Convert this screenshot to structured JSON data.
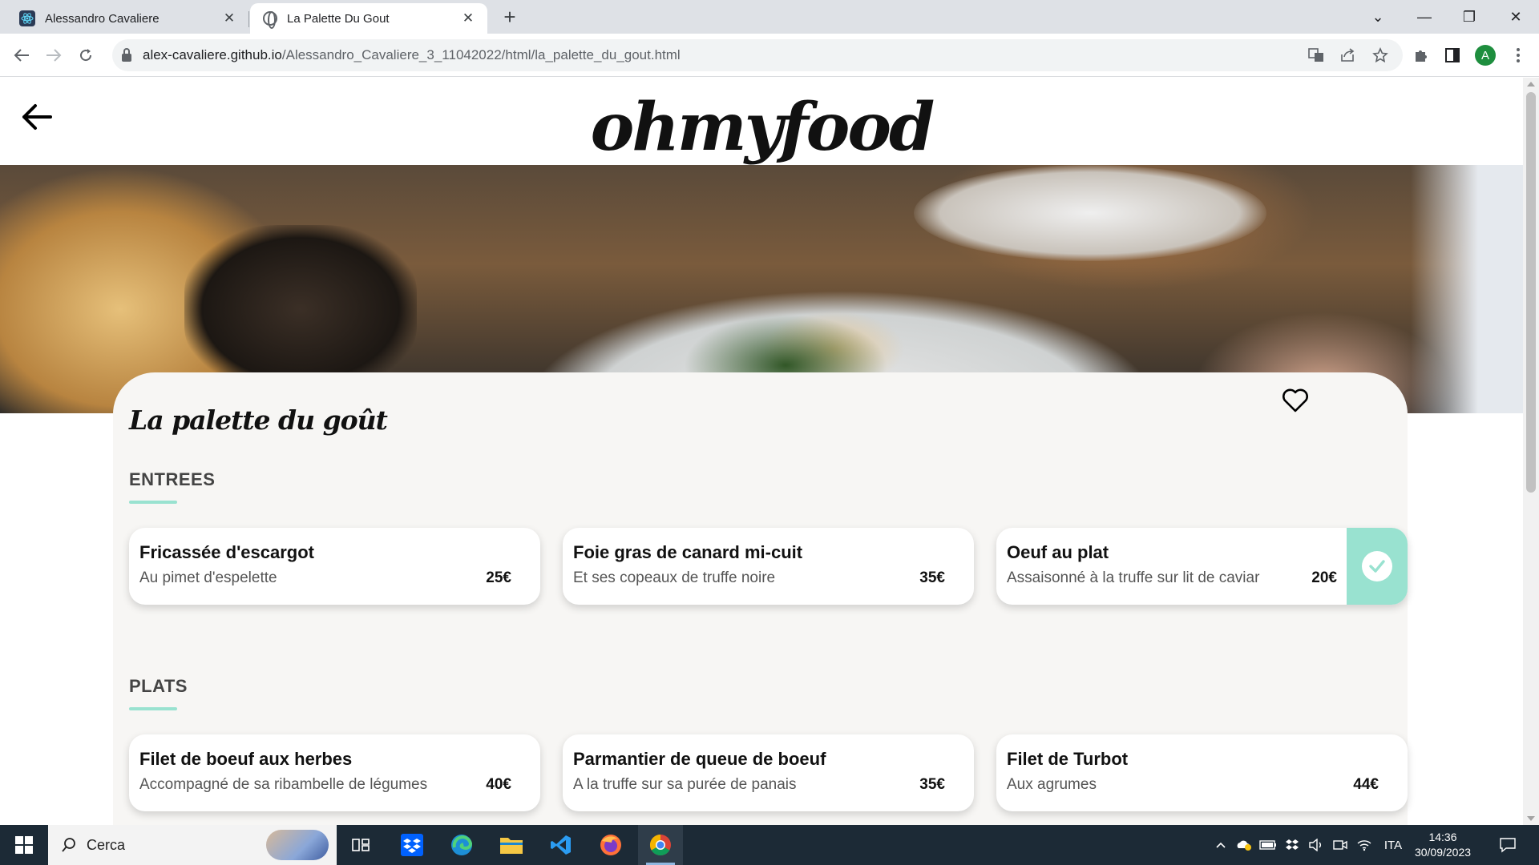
{
  "browser": {
    "tabs": [
      {
        "title": "Alessandro Cavaliere",
        "close": "✕"
      },
      {
        "title": "La Palette Du Gout",
        "close": "✕"
      }
    ],
    "new_tab": "+",
    "window_controls": {
      "dropdown": "⌄",
      "minimize": "—",
      "restore": "❐",
      "close": "✕"
    },
    "url_host": "alex-cavaliere.github.io",
    "url_path": "/Alessandro_Cavaliere_3_11042022/html/la_palette_du_gout.html",
    "profile_initial": "A"
  },
  "site": {
    "logo": "ohmyfood",
    "restaurant_name": "La palette du goût",
    "accent_color": "#99e2d0",
    "sections": [
      {
        "title": "ENTREES",
        "dishes": [
          {
            "name": "Fricassée d'escargot",
            "description": "Au pimet d'espelette",
            "price": "25€",
            "selected": false
          },
          {
            "name": "Foie gras de canard mi-cuit",
            "description": "Et ses copeaux de truffe noire",
            "price": "35€",
            "selected": false
          },
          {
            "name": "Oeuf au plat",
            "description": "Assaisonné à la truffe sur lit de caviar",
            "price": "20€",
            "selected": true
          }
        ]
      },
      {
        "title": "PLATS",
        "dishes": [
          {
            "name": "Filet de boeuf aux herbes",
            "description": "Accompagné de sa ribambelle de légumes",
            "price": "40€",
            "selected": false
          },
          {
            "name": "Parmantier de queue de boeuf",
            "description": "A la truffe sur sa purée de panais",
            "price": "35€",
            "selected": false
          },
          {
            "name": "Filet de Turbot",
            "description": "Aux agrumes",
            "price": "44€",
            "selected": false
          }
        ]
      }
    ]
  },
  "taskbar": {
    "search_placeholder": "Cerca",
    "language": "ITA",
    "time": "14:36",
    "date": "30/09/2023"
  }
}
